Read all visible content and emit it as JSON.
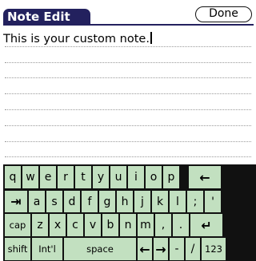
{
  "header": {
    "title": "Note Edit",
    "done_label": "Done"
  },
  "note": {
    "text": "This is your custom note."
  },
  "keyboard": {
    "rows": [
      [
        {
          "name": "key-q",
          "label": "q"
        },
        {
          "name": "key-w",
          "label": "w"
        },
        {
          "name": "key-e",
          "label": "e"
        },
        {
          "name": "key-r",
          "label": "r"
        },
        {
          "name": "key-t",
          "label": "t"
        },
        {
          "name": "key-y",
          "label": "y"
        },
        {
          "name": "key-u",
          "label": "u"
        },
        {
          "name": "key-i",
          "label": "i"
        },
        {
          "name": "key-o",
          "label": "o"
        },
        {
          "name": "key-p",
          "label": "p"
        },
        {
          "name": "backspace-key",
          "label": "←",
          "icon": "backspace-arrow-icon"
        }
      ],
      [
        {
          "name": "tab-key",
          "label": "⇥",
          "icon": "tab-arrow-icon"
        },
        {
          "name": "key-a",
          "label": "a"
        },
        {
          "name": "key-s",
          "label": "s"
        },
        {
          "name": "key-d",
          "label": "d"
        },
        {
          "name": "key-f",
          "label": "f"
        },
        {
          "name": "key-g",
          "label": "g"
        },
        {
          "name": "key-h",
          "label": "h"
        },
        {
          "name": "key-j",
          "label": "j"
        },
        {
          "name": "key-k",
          "label": "k"
        },
        {
          "name": "key-l",
          "label": "l"
        },
        {
          "name": "key-semicolon",
          "label": ";"
        },
        {
          "name": "key-apostrophe",
          "label": "'"
        }
      ],
      [
        {
          "name": "caps-key",
          "label": "cap"
        },
        {
          "name": "key-z",
          "label": "z"
        },
        {
          "name": "key-x",
          "label": "x"
        },
        {
          "name": "key-c",
          "label": "c"
        },
        {
          "name": "key-v",
          "label": "v"
        },
        {
          "name": "key-b",
          "label": "b"
        },
        {
          "name": "key-n",
          "label": "n"
        },
        {
          "name": "key-m",
          "label": "m"
        },
        {
          "name": "key-comma",
          "label": ","
        },
        {
          "name": "key-period",
          "label": "."
        },
        {
          "name": "return-key",
          "label": "↵",
          "icon": "return-arrow-icon"
        }
      ],
      [
        {
          "name": "shift-key",
          "label": "shift"
        },
        {
          "name": "intl-key",
          "label": "Int'l"
        },
        {
          "name": "space-key",
          "label": "space"
        },
        {
          "name": "left-arrow-key",
          "label": "←",
          "icon": "left-arrow-icon"
        },
        {
          "name": "right-arrow-key",
          "label": "→",
          "icon": "right-arrow-icon"
        },
        {
          "name": "key-minus",
          "label": "-"
        },
        {
          "name": "key-slash",
          "label": "/"
        },
        {
          "name": "numbers-key",
          "label": "123"
        }
      ]
    ]
  }
}
